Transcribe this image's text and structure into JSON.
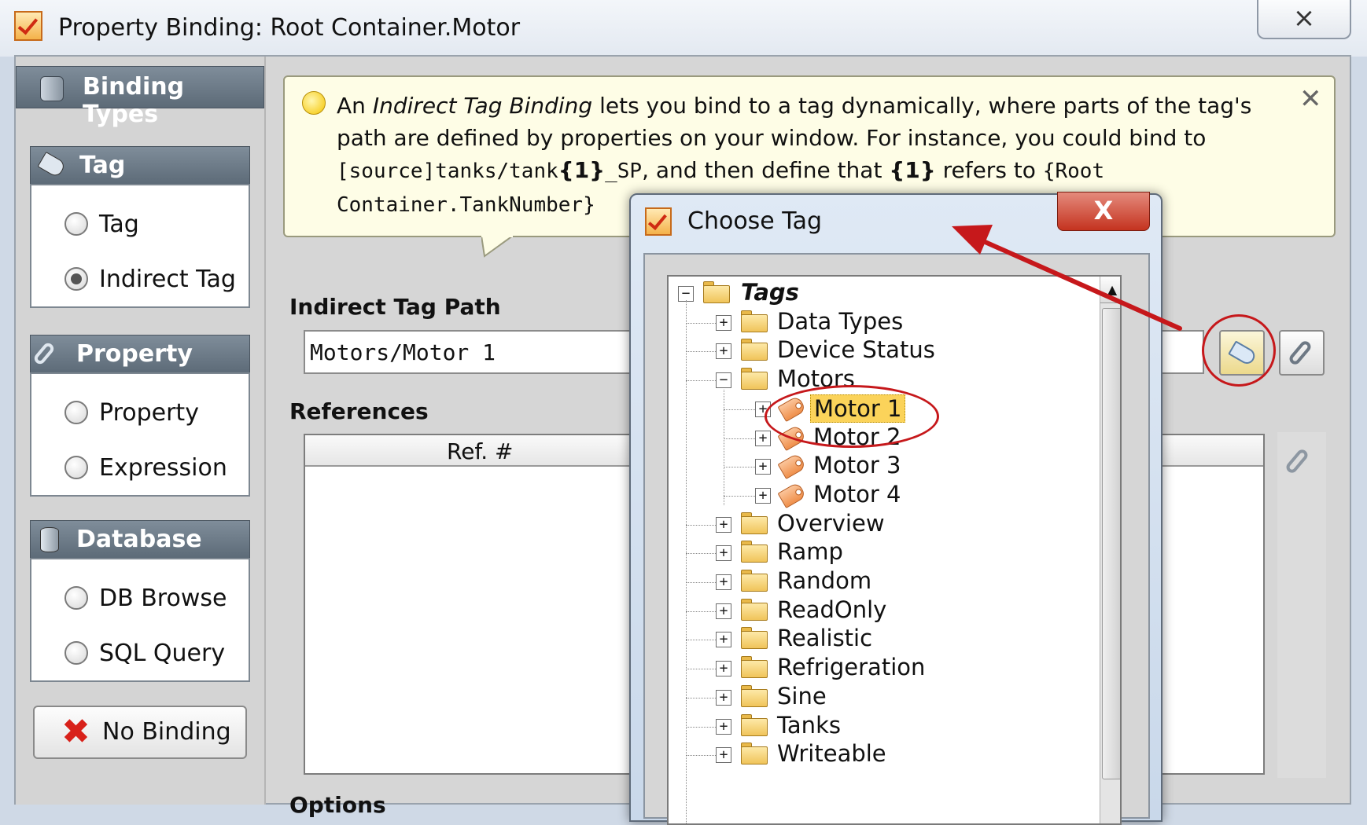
{
  "window": {
    "title": "Property Binding: Root Container.Motor",
    "close_glyph": "⨯"
  },
  "binding_types": {
    "header": "Binding Types",
    "groups": [
      {
        "title": "Tag",
        "options": [
          {
            "label": "Tag",
            "selected": false
          },
          {
            "label": "Indirect Tag",
            "selected": true
          }
        ]
      },
      {
        "title": "Property",
        "options": [
          {
            "label": "Property",
            "selected": false
          },
          {
            "label": "Expression",
            "selected": false
          }
        ]
      },
      {
        "title": "Database",
        "options": [
          {
            "label": "DB Browse",
            "selected": false
          },
          {
            "label": "SQL Query",
            "selected": false
          }
        ]
      }
    ],
    "no_binding_label": "No Binding"
  },
  "info": {
    "line1_pre": "An ",
    "line1_em": "Indirect Tag Binding",
    "line1_post": " lets you bind to a tag dynamically, where parts of the tag's",
    "line2": "path are defined by properties on your window. For instance, you could bind to",
    "line3_code1": "[source]tanks/tank",
    "line3_bold1": "{1}",
    "line3_code2": "_SP",
    "line3_text": ", and then define that ",
    "line3_bold2": "{1}",
    "line3_text2": " refers to ",
    "line3_code3": "{Root",
    "line4_code": "Container.TankNumber}"
  },
  "indirect_tag_path": {
    "label": "Indirect Tag Path",
    "value": "Motors/Motor 1"
  },
  "references": {
    "label": "References",
    "column": "Ref. #"
  },
  "options_label": "Options",
  "choose_tag": {
    "title": "Choose Tag",
    "close_glyph": "X",
    "tree": {
      "root": "Tags",
      "items": [
        {
          "label": "Data Types",
          "expander": "+"
        },
        {
          "label": "Device Status",
          "expander": "+"
        },
        {
          "label": "Motors",
          "expander": "−",
          "children": [
            {
              "label": "Motor 1",
              "selected": true
            },
            {
              "label": "Motor 2",
              "selected": false
            },
            {
              "label": "Motor 3",
              "selected": false
            },
            {
              "label": "Motor 4",
              "selected": false
            }
          ]
        },
        {
          "label": "Overview",
          "expander": "+"
        },
        {
          "label": "Ramp",
          "expander": "+"
        },
        {
          "label": "Random",
          "expander": "+"
        },
        {
          "label": "ReadOnly",
          "expander": "+"
        },
        {
          "label": "Realistic",
          "expander": "+"
        },
        {
          "label": "Refrigeration",
          "expander": "+"
        },
        {
          "label": "Sine",
          "expander": "+"
        },
        {
          "label": "Tanks",
          "expander": "+"
        },
        {
          "label": "Writeable",
          "expander": "+"
        }
      ]
    }
  },
  "colors": {
    "annotation": "#c6181b",
    "header_bg": "#6d7a87",
    "selection": "#fbd35a",
    "balloon": "#fefde6"
  },
  "icons": [
    "app-icon",
    "binding-types-icon",
    "tag-icon",
    "property-icon",
    "database-icon",
    "lightbulb-icon",
    "close-icon",
    "browse-tag-icon",
    "link-icon",
    "folder-icon",
    "delete-x-icon"
  ]
}
